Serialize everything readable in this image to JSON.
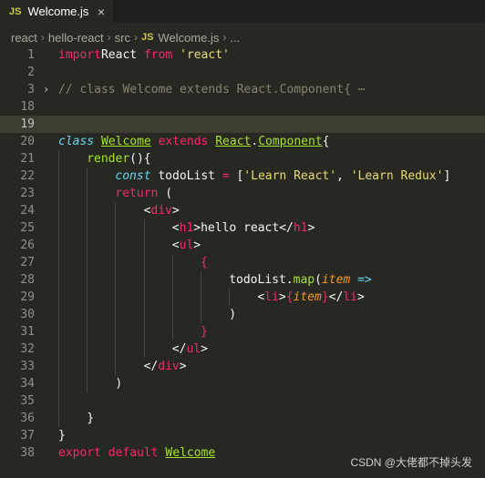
{
  "tab": {
    "badge": "JS",
    "title": "Welcome.js",
    "close": "×"
  },
  "breadcrumb": {
    "items": [
      "react",
      "hello-react",
      "src"
    ],
    "file_badge": "JS",
    "file": "Welcome.js",
    "more": "..."
  },
  "editor": {
    "lines": [
      {
        "n": "1",
        "tokens": [
          [
            "k",
            "import"
          ],
          [
            "",
            "React "
          ],
          [
            "k",
            "from "
          ],
          [
            "s",
            "'react'"
          ]
        ]
      },
      {
        "n": "2",
        "tokens": []
      },
      {
        "n": "3",
        "fold": true,
        "tokens": [
          [
            "c",
            "// class Welcome extends React.Component{"
          ],
          [
            "dots",
            " ⋯"
          ]
        ]
      },
      {
        "n": "18",
        "tokens": []
      },
      {
        "n": "19",
        "active": true,
        "tokens": []
      },
      {
        "n": "20",
        "tokens": [
          [
            "sto",
            "class "
          ],
          [
            "cls",
            "Welcome"
          ],
          [
            "",
            " "
          ],
          [
            "k",
            "extends "
          ],
          [
            "cls",
            "React"
          ],
          [
            "",
            "."
          ],
          [
            "cls",
            "Component"
          ],
          [
            "",
            "{"
          ]
        ]
      },
      {
        "n": "21",
        "indent": 1,
        "tokens": [
          [
            "fn",
            "render"
          ],
          [
            "",
            "(){"
          ]
        ]
      },
      {
        "n": "22",
        "indent": 2,
        "tokens": [
          [
            "sto",
            "const "
          ],
          [
            "",
            "todoList "
          ],
          [
            "k",
            "= "
          ],
          [
            "",
            "["
          ],
          [
            "s",
            "'Learn React'"
          ],
          [
            ", "
          ],
          [
            "s",
            "'Learn Redux'"
          ],
          [
            "",
            "]"
          ]
        ]
      },
      {
        "n": "23",
        "indent": 2,
        "tokens": [
          [
            "k",
            "return "
          ],
          [
            "",
            "("
          ]
        ]
      },
      {
        "n": "24",
        "indent": 3,
        "tokens": [
          [
            "",
            "<"
          ],
          [
            "t",
            "div"
          ],
          [
            "",
            ">"
          ]
        ]
      },
      {
        "n": "25",
        "indent": 4,
        "tokens": [
          [
            "",
            "<"
          ],
          [
            "t",
            "h1"
          ],
          [
            "",
            ">hello react</"
          ],
          [
            "t",
            "h1"
          ],
          [
            "",
            ">"
          ]
        ]
      },
      {
        "n": "26",
        "indent": 4,
        "tokens": [
          [
            "",
            "<"
          ],
          [
            "t",
            "ul"
          ],
          [
            "",
            ">"
          ]
        ]
      },
      {
        "n": "27",
        "indent": 5,
        "tokens": [
          [
            "k",
            "{"
          ]
        ]
      },
      {
        "n": "28",
        "indent": 6,
        "tokens": [
          [
            "",
            "todoList."
          ],
          [
            "fn",
            "map"
          ],
          [
            "",
            "("
          ],
          [
            "p",
            "item "
          ],
          [
            "sto",
            "=>"
          ]
        ]
      },
      {
        "n": "29",
        "indent": 7,
        "tokens": [
          [
            "",
            "<"
          ],
          [
            "t",
            "li"
          ],
          [
            "",
            ">"
          ],
          [
            "k",
            "{"
          ],
          [
            "p",
            "item"
          ],
          [
            "k",
            "}"
          ],
          [
            "",
            "</"
          ],
          [
            "t",
            "li"
          ],
          [
            "",
            ">"
          ]
        ]
      },
      {
        "n": "30",
        "indent": 6,
        "tokens": [
          [
            "",
            ")"
          ]
        ]
      },
      {
        "n": "31",
        "indent": 5,
        "tokens": [
          [
            "k",
            "}"
          ]
        ]
      },
      {
        "n": "32",
        "indent": 4,
        "tokens": [
          [
            "",
            "</"
          ],
          [
            "t",
            "ul"
          ],
          [
            "",
            ">"
          ]
        ]
      },
      {
        "n": "33",
        "indent": 3,
        "tokens": [
          [
            "",
            "</"
          ],
          [
            "t",
            "div"
          ],
          [
            "",
            ">"
          ]
        ]
      },
      {
        "n": "34",
        "indent": 2,
        "tokens": [
          [
            "",
            ")"
          ]
        ]
      },
      {
        "n": "35",
        "indent": 1,
        "tokens": []
      },
      {
        "n": "36",
        "indent": 1,
        "tokens": [
          [
            "",
            "}"
          ]
        ]
      },
      {
        "n": "37",
        "tokens": [
          [
            "",
            "}"
          ]
        ]
      },
      {
        "n": "38",
        "tokens": [
          [
            "k",
            "export "
          ],
          [
            "k",
            "default "
          ],
          [
            "cls",
            "Welcome"
          ]
        ]
      }
    ]
  },
  "watermark": "CSDN @大佬都不掉头发",
  "colors": {
    "background": "#272822",
    "keyword": "#f92672",
    "string": "#e6db74",
    "comment": "#88846f",
    "class": "#a6e22e",
    "storage": "#66d9ef",
    "param": "#fd971f"
  }
}
